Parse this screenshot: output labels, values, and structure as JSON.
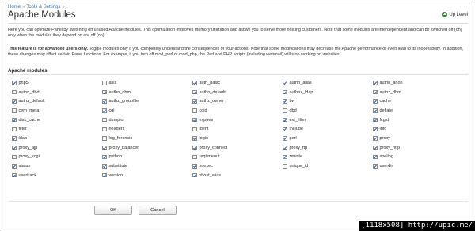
{
  "breadcrumb": {
    "items": [
      "Home",
      "Tools & Settings"
    ]
  },
  "page": {
    "title": "Apache Modules",
    "up_level_label": "Up Level"
  },
  "description": {
    "paragraph1": "Here you can optimize Panel by switching off unused Apache modules. This optimization improves memory utilization and allows you to serve more hosting customers. Note that some modules are interdependent and can be switched off (on) only when the modules they depend on are off (on).",
    "warning_bold": "This feature is for advanced users only.",
    "warning_rest": " Toggle modules only if you completely understand the consequences of your actions. Note that some modifications may decrease the Apache performance or even lead to its inoperability. In addition, these changes may affect certain Panel functions. For example, if you turn off mod_perl or mod_php, the Perl and PHP scripts (including webmail) will stop working on websites."
  },
  "section": {
    "title": "Apache modules"
  },
  "modules": [
    {
      "name": "php5",
      "checked": true
    },
    {
      "name": "asis",
      "checked": false
    },
    {
      "name": "auth_basic",
      "checked": true
    },
    {
      "name": "authn_alias",
      "checked": true
    },
    {
      "name": "authn_anon",
      "checked": true
    },
    {
      "name": "authn_dbd",
      "checked": false
    },
    {
      "name": "authn_dbm",
      "checked": true
    },
    {
      "name": "authn_default",
      "checked": true
    },
    {
      "name": "authnz_ldap",
      "checked": true
    },
    {
      "name": "authz_dbm",
      "checked": true
    },
    {
      "name": "authz_default",
      "checked": true
    },
    {
      "name": "authz_groupfile",
      "checked": true
    },
    {
      "name": "authz_owner",
      "checked": true
    },
    {
      "name": "bw",
      "checked": true
    },
    {
      "name": "cache",
      "checked": true
    },
    {
      "name": "cern_meta",
      "checked": false
    },
    {
      "name": "cgi",
      "checked": true
    },
    {
      "name": "cgid",
      "checked": false
    },
    {
      "name": "dbd",
      "checked": false
    },
    {
      "name": "deflate",
      "checked": true
    },
    {
      "name": "disk_cache",
      "checked": true
    },
    {
      "name": "dumpio",
      "checked": false
    },
    {
      "name": "expires",
      "checked": true
    },
    {
      "name": "ext_filter",
      "checked": true
    },
    {
      "name": "fcgid",
      "checked": true
    },
    {
      "name": "filter",
      "checked": false
    },
    {
      "name": "headers",
      "checked": false
    },
    {
      "name": "ident",
      "checked": false
    },
    {
      "name": "include",
      "checked": true
    },
    {
      "name": "info",
      "checked": true
    },
    {
      "name": "ldap",
      "checked": true
    },
    {
      "name": "log_forensic",
      "checked": false
    },
    {
      "name": "logio",
      "checked": true
    },
    {
      "name": "perl",
      "checked": true
    },
    {
      "name": "proxy",
      "checked": true
    },
    {
      "name": "proxy_ajp",
      "checked": true
    },
    {
      "name": "proxy_balancer",
      "checked": true
    },
    {
      "name": "proxy_connect",
      "checked": true
    },
    {
      "name": "proxy_ftp",
      "checked": true
    },
    {
      "name": "proxy_http",
      "checked": true
    },
    {
      "name": "proxy_scgi",
      "checked": false
    },
    {
      "name": "python",
      "checked": true
    },
    {
      "name": "reqtimeout",
      "checked": false
    },
    {
      "name": "rewrite",
      "checked": true
    },
    {
      "name": "speling",
      "checked": true
    },
    {
      "name": "status",
      "checked": true
    },
    {
      "name": "substitute",
      "checked": true
    },
    {
      "name": "suexec",
      "checked": true
    },
    {
      "name": "unique_id",
      "checked": false
    },
    {
      "name": "userdir",
      "checked": true
    },
    {
      "name": "usertrack",
      "checked": true
    },
    {
      "name": "version",
      "checked": true
    },
    {
      "name": "vhost_alias",
      "checked": true
    }
  ],
  "buttons": {
    "ok_label": "OK",
    "cancel_label": "Cancel"
  },
  "watermark": {
    "text": "[1118x508] http://upic.me/"
  },
  "icons": {
    "up_level": "up-arrow-icon",
    "checkbox_checked": "checkmark-icon"
  },
  "colors": {
    "link": "#3a6fb0",
    "up_icon": "#2f8a2f",
    "check": "#2b5fa0"
  }
}
